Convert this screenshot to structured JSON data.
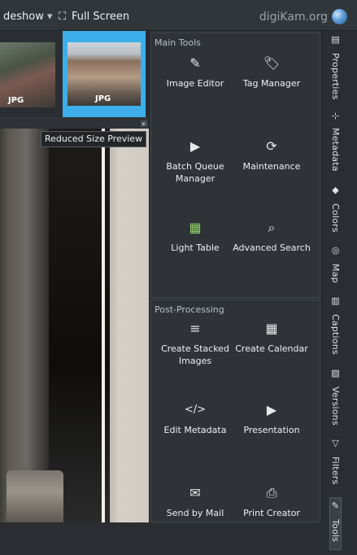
{
  "topbar": {
    "slideshow_label": "deshow",
    "fullscreen_label": "Full Screen",
    "brand": "digiKam.org"
  },
  "filmstrip": {
    "thumbs": [
      {
        "format": "JPG",
        "selected": false
      },
      {
        "format": "JPG",
        "selected": true
      }
    ]
  },
  "preview": {
    "tooltip": "Reduced Size Preview"
  },
  "main_tools": {
    "title": "Main Tools",
    "items": [
      {
        "label": "Image Editor",
        "icon": "pencil-icon",
        "glyph": "✎"
      },
      {
        "label": "Tag Manager",
        "icon": "tag-icon",
        "glyph": "🏷"
      },
      {
        "label": "Batch Queue Manager",
        "icon": "play-circle-icon",
        "glyph": "▶"
      },
      {
        "label": "Maintenance",
        "icon": "maintenance-icon",
        "glyph": "⟳"
      },
      {
        "label": "Light Table",
        "icon": "light-table-icon",
        "glyph": "▦"
      },
      {
        "label": "Advanced Search",
        "icon": "search-icon",
        "glyph": "⌕"
      }
    ]
  },
  "post_processing": {
    "title": "Post-Processing",
    "items": [
      {
        "label": "Create Stacked Images",
        "icon": "stack-icon",
        "glyph": "≡"
      },
      {
        "label": "Create Calendar",
        "icon": "calendar-icon",
        "glyph": "▦"
      },
      {
        "label": "Edit Metadata",
        "icon": "code-icon",
        "glyph": "</>"
      },
      {
        "label": "Presentation",
        "icon": "presentation-icon",
        "glyph": "▶"
      },
      {
        "label": "Send by Mail",
        "icon": "mail-icon",
        "glyph": "✉"
      },
      {
        "label": "Print Creator",
        "icon": "printer-icon",
        "glyph": "⎙"
      }
    ]
  },
  "right_tabs": [
    {
      "label": "Properties",
      "icon": "▤"
    },
    {
      "label": "Metadata",
      "icon": "⊹"
    },
    {
      "label": "Colors",
      "icon": "◆"
    },
    {
      "label": "Map",
      "icon": "◎"
    },
    {
      "label": "Captions",
      "icon": "▥"
    },
    {
      "label": "Versions",
      "icon": "▧"
    },
    {
      "label": "Filters",
      "icon": "▽"
    },
    {
      "label": "Tools",
      "icon": "✎"
    }
  ],
  "accent": "#3daee9"
}
